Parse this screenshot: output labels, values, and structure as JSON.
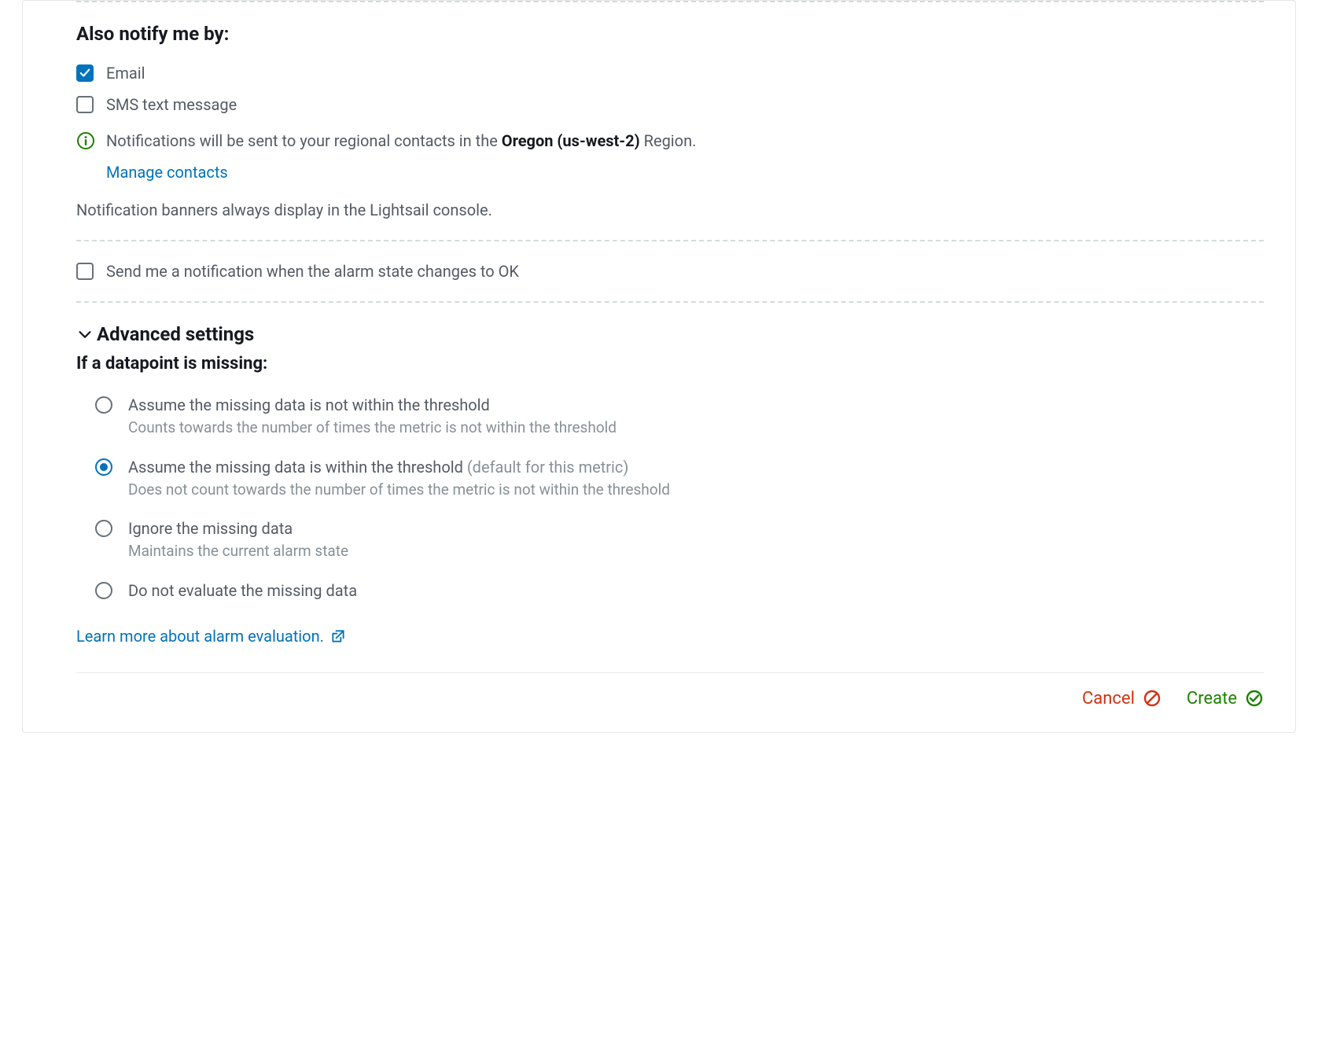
{
  "notify": {
    "heading": "Also notify me by:",
    "email": {
      "label": "Email",
      "checked": true
    },
    "sms": {
      "label": "SMS text message",
      "checked": false
    },
    "info_prefix": "Notifications will be sent to your regional contacts in the ",
    "info_region": "Oregon (us-west-2)",
    "info_suffix": " Region.",
    "manage_link": "Manage contacts",
    "banner_note": "Notification banners always display in the Lightsail console.",
    "ok_notify": {
      "label": "Send me a notification when the alarm state changes to OK",
      "checked": false
    }
  },
  "advanced": {
    "title": "Advanced settings",
    "missing_heading": "If a datapoint is missing:",
    "options": [
      {
        "label": "Assume the missing data is not within the threshold",
        "default_note": "",
        "desc": "Counts towards the number of times the metric is not within the threshold",
        "selected": false
      },
      {
        "label": "Assume the missing data is within the threshold",
        "default_note": " (default for this metric)",
        "desc": "Does not count towards the number of times the metric is not within the threshold",
        "selected": true
      },
      {
        "label": "Ignore the missing data",
        "default_note": "",
        "desc": "Maintains the current alarm state",
        "selected": false
      },
      {
        "label": "Do not evaluate the missing data",
        "default_note": "",
        "desc": "",
        "selected": false
      }
    ],
    "learn_link": "Learn more about alarm evaluation."
  },
  "actions": {
    "cancel": "Cancel",
    "create": "Create"
  }
}
